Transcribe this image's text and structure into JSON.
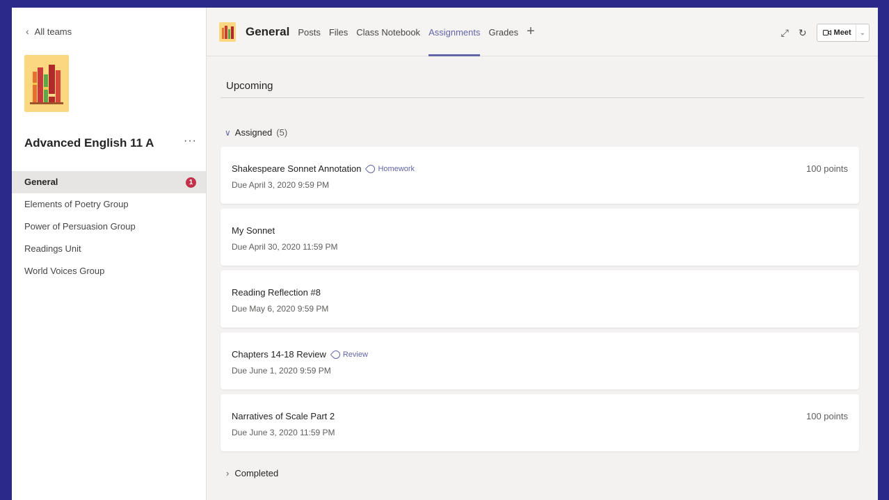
{
  "sidebar": {
    "back_label": "All teams",
    "team_name": "Advanced English 11 A",
    "more": "···",
    "channels": [
      {
        "label": "General",
        "badge": "1"
      },
      {
        "label": "Elements of Poetry Group"
      },
      {
        "label": "Power of Persuasion Group"
      },
      {
        "label": "Readings Unit"
      },
      {
        "label": "World Voices Group"
      }
    ]
  },
  "header": {
    "channel_title": "General",
    "tabs": [
      "Posts",
      "Files",
      "Class Notebook",
      "Assignments",
      "Grades"
    ],
    "add_tab": "+",
    "meet_label": "Meet"
  },
  "main": {
    "section_title": "Upcoming",
    "assigned_label": "Assigned",
    "assigned_count": "(5)",
    "completed_label": "Completed",
    "assignments": [
      {
        "title": "Shakespeare Sonnet Annotation",
        "tag": "Homework",
        "due": "Due April 3, 2020 9:59 PM",
        "points": "100 points"
      },
      {
        "title": "My Sonnet",
        "tag": "",
        "due": "Due April 30, 2020 11:59 PM",
        "points": ""
      },
      {
        "title": "Reading Reflection #8",
        "tag": "",
        "due": "Due May 6, 2020 9:59 PM",
        "points": ""
      },
      {
        "title": "Chapters 14-18 Review",
        "tag": "Review",
        "due": "Due June 1, 2020 9:59 PM",
        "points": ""
      },
      {
        "title": "Narratives of Scale Part 2",
        "tag": "",
        "due": "Due June 3, 2020 11:59 PM",
        "points": "100 points"
      }
    ]
  },
  "colors": {
    "accent": "#6264a7",
    "badge": "#c4314b",
    "team_logo_bg": "#fbd77f",
    "border": "#2b2a8a"
  }
}
